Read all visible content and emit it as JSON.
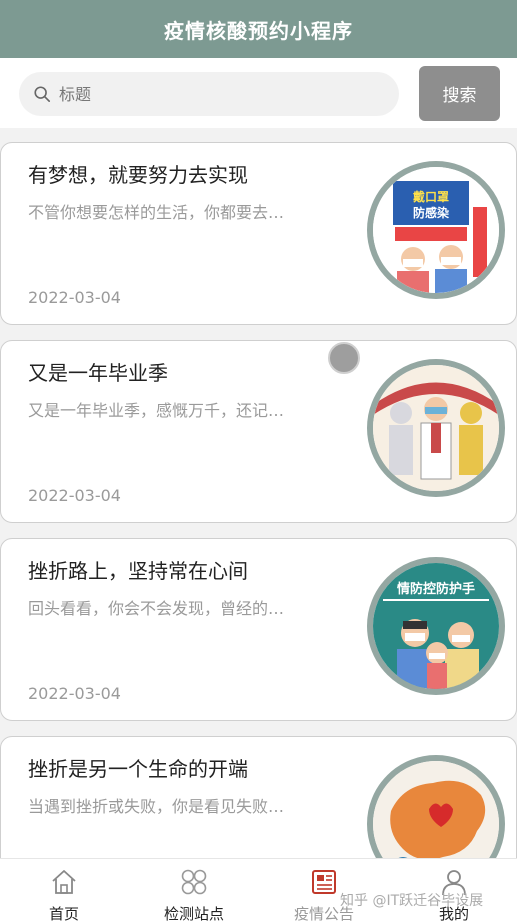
{
  "header": {
    "title": "疫情核酸预约小程序"
  },
  "search": {
    "placeholder": "标题",
    "value": "",
    "button_label": "搜索"
  },
  "articles": [
    {
      "title": "有梦想，就要努力去实现",
      "summary": "不管你想要怎样的生活，你都要去…",
      "date": "2022-03-04",
      "image_text": [
        "戴口罩",
        "防感染"
      ]
    },
    {
      "title": "又是一年毕业季",
      "summary": "又是一年毕业季，感慨万千，还记…",
      "date": "2022-03-04"
    },
    {
      "title": "挫折路上，坚持常在心间",
      "summary": "回头看看，你会不会发现，曾经的…",
      "date": "2022-03-04",
      "image_text": [
        "情防控防护手"
      ]
    },
    {
      "title": "挫折是另一个生命的开端",
      "summary": "当遇到挫折或失败，你是看见失败…"
    }
  ],
  "tabbar": {
    "items": [
      {
        "label": "首页",
        "icon": "home-icon"
      },
      {
        "label": "检测站点",
        "icon": "grid-icon"
      },
      {
        "label": "疫情公告",
        "icon": "news-icon",
        "active": true
      },
      {
        "label": "我的",
        "icon": "user-icon"
      }
    ]
  },
  "watermark": "知乎 @IT跃迁谷毕设展",
  "colors": {
    "header_bg": "#7d9a92",
    "thumb_border": "#94a7a2",
    "button_bg": "#8e8e8e",
    "news_icon": "#c0392b"
  }
}
